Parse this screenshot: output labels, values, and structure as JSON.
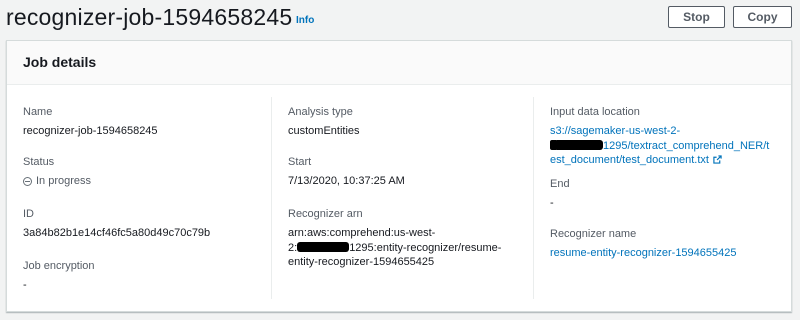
{
  "header": {
    "title": "recognizer-job-1594658245",
    "info_label": "Info",
    "stop_label": "Stop",
    "copy_label": "Copy"
  },
  "panel": {
    "title": "Job details"
  },
  "fields": {
    "name": {
      "label": "Name",
      "value": "recognizer-job-1594658245"
    },
    "status": {
      "label": "Status",
      "value": "In progress"
    },
    "id": {
      "label": "ID",
      "value": "3a84b82b1e14cf46fc5a80d49c70c79b"
    },
    "job_encryption": {
      "label": "Job encryption",
      "value": "-"
    },
    "analysis_type": {
      "label": "Analysis type",
      "value": "customEntities"
    },
    "start": {
      "label": "Start",
      "value": "7/13/2020, 10:37:25 AM"
    },
    "recognizer_arn": {
      "label": "Recognizer arn",
      "line1": "arn:aws:comprehend:us-west-",
      "line2_prefix": "2:",
      "line2_suffix": "1295:entity-recognizer/resume-",
      "line3": "entity-recognizer-1594655425"
    },
    "input_location": {
      "label": "Input data location",
      "line1": "s3://sagemaker-us-west-2-",
      "line2_suffix": "1295/textract_comprehend_NER/t",
      "line3": "est_document/test_document.txt"
    },
    "end": {
      "label": "End",
      "value": "-"
    },
    "recognizer_name": {
      "label": "Recognizer name",
      "value": "resume-entity-recognizer-1594655425"
    }
  },
  "colors": {
    "link": "#0073bb",
    "text": "#16191f",
    "label": "#545b64",
    "redaction": "#000000"
  },
  "icons": {
    "status": "in-progress-icon",
    "external": "external-link-icon"
  }
}
